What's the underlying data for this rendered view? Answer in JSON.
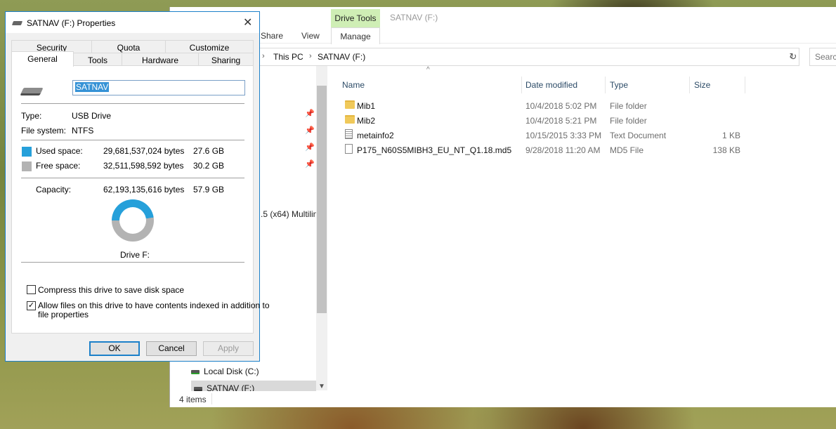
{
  "explorer": {
    "context_tab": "Drive Tools",
    "title": "SATNAV (F:)",
    "ribbon_tabs": [
      "Share",
      "View",
      "Manage"
    ],
    "breadcrumb": [
      "This PC",
      "SATNAV (F:)"
    ],
    "search_placeholder": "Search",
    "nav_partial_text": ".5 (x64) Multilin",
    "nav_items": [
      {
        "label": "Local Disk (C:)",
        "selected": false
      },
      {
        "label": "SATNAV (F:)",
        "selected": true
      }
    ],
    "columns": {
      "name": "Name",
      "date": "Date modified",
      "type": "Type",
      "size": "Size"
    },
    "files": [
      {
        "name": "Mib1",
        "date": "10/4/2018 5:02 PM",
        "type": "File folder",
        "size": "",
        "icon": "folder-icon"
      },
      {
        "name": "Mib2",
        "date": "10/4/2018 5:21 PM",
        "type": "File folder",
        "size": "",
        "icon": "folder-icon"
      },
      {
        "name": "metainfo2",
        "date": "10/15/2015 3:33 PM",
        "type": "Text Document",
        "size": "1 KB",
        "icon": "text-document-icon"
      },
      {
        "name": "P175_N60S5MIBH3_EU_NT_Q1.18.md5",
        "date": "9/28/2018 11:20 AM",
        "type": "MD5 File",
        "size": "138 KB",
        "icon": "file-icon"
      }
    ],
    "status": "4 items"
  },
  "dialog": {
    "title": "SATNAV (F:) Properties",
    "tabs_row1": [
      "Security",
      "Quota",
      "Customize"
    ],
    "tabs_row2": [
      "General",
      "Tools",
      "Hardware",
      "Sharing"
    ],
    "active_tab": "General",
    "drive_name": "SATNAV",
    "type_label": "Type:",
    "type_value": "USB Drive",
    "fs_label": "File system:",
    "fs_value": "NTFS",
    "used_label": "Used space:",
    "used_bytes": "29,681,537,024 bytes",
    "used_gb": "27.6 GB",
    "free_label": "Free space:",
    "free_bytes": "32,511,598,592 bytes",
    "free_gb": "30.2 GB",
    "capacity_label": "Capacity:",
    "capacity_bytes": "62,193,135,616 bytes",
    "capacity_gb": "57.9 GB",
    "used_fraction": 0.477,
    "drive_label": "Drive F:",
    "compress_label": "Compress this drive to save disk space",
    "compress_checked": false,
    "index_label_line1": "Allow files on this drive to have contents indexed in addition to",
    "index_label_line2": "file properties",
    "index_checked": true,
    "buttons": {
      "ok": "OK",
      "cancel": "Cancel",
      "apply": "Apply"
    },
    "colors": {
      "used": "#26a0da",
      "free": "#b3b3b3",
      "accent": "#1c80c9"
    }
  }
}
